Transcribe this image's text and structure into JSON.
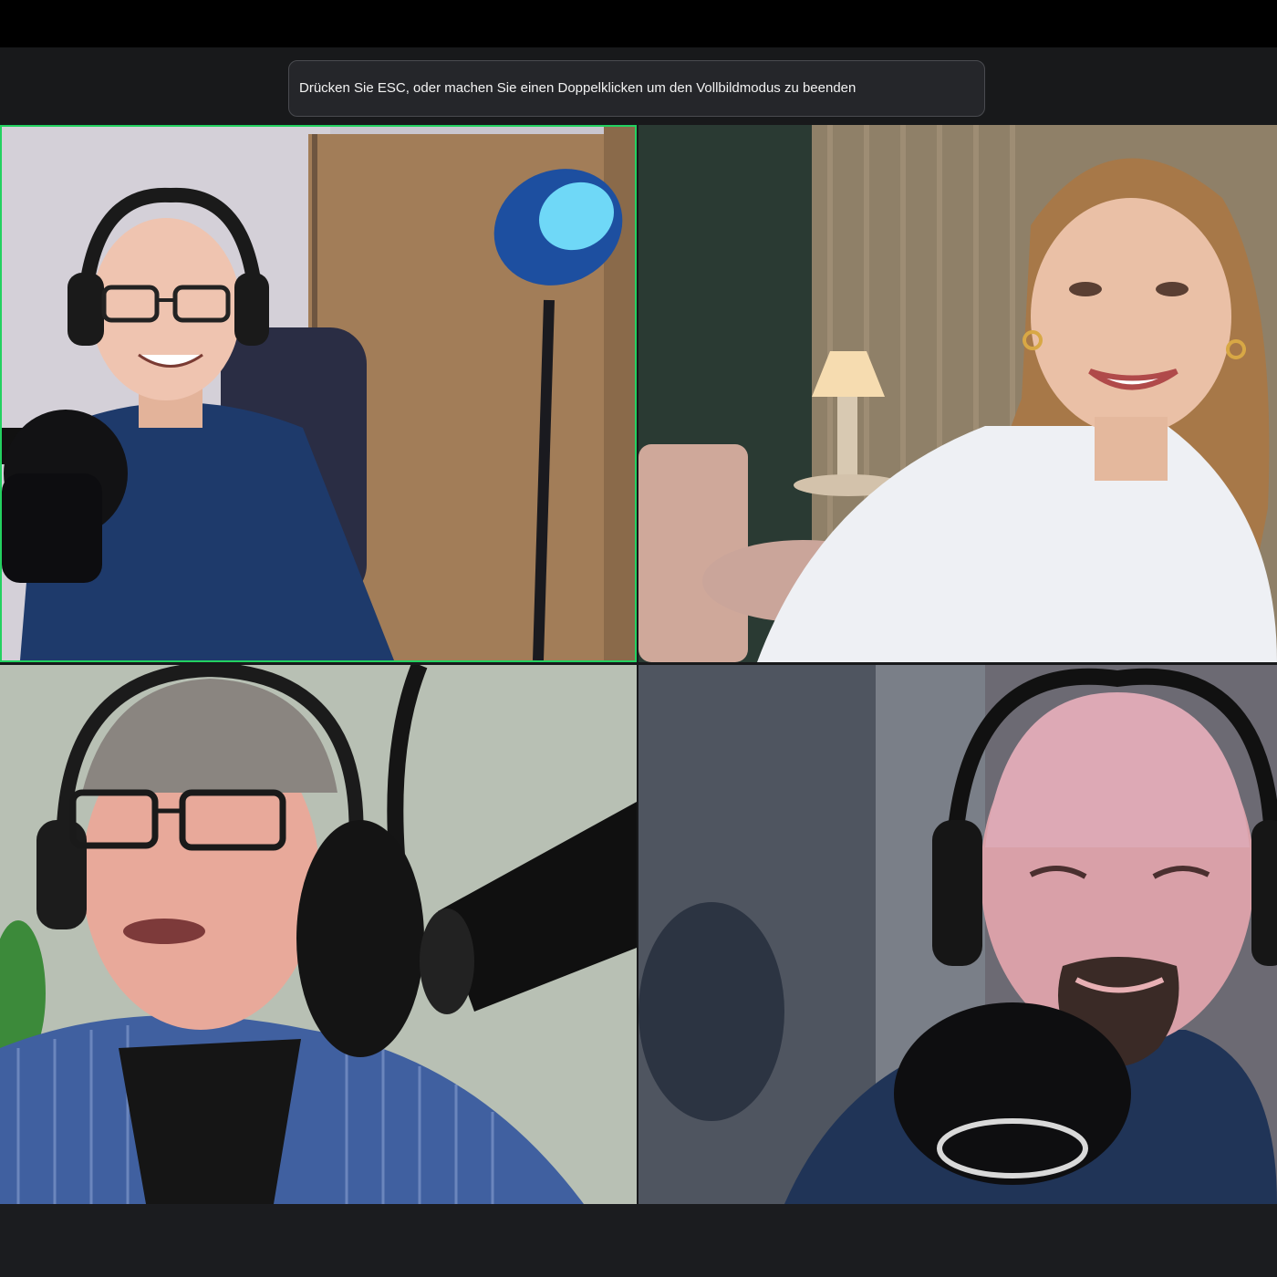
{
  "notice": {
    "text": "Drücken Sie ESC, oder machen Sie einen Doppelklicken um den Vollbildmodus zu beenden"
  },
  "participants": [
    {
      "id": "top-left",
      "active_speaker": true,
      "description": "man with glasses and headphones, blue t-shirt, blue lamp"
    },
    {
      "id": "top-right",
      "active_speaker": false,
      "description": "woman with long hair, white blouse, lamp in background"
    },
    {
      "id": "bottom-left",
      "active_speaker": false,
      "description": "man with glasses and headphones, striped shirt, microphone"
    },
    {
      "id": "bottom-right",
      "active_speaker": false,
      "description": "bald man with headphones and goatee, microphone"
    }
  ],
  "colors": {
    "active_border": "#23d160",
    "background": "#18191b"
  }
}
